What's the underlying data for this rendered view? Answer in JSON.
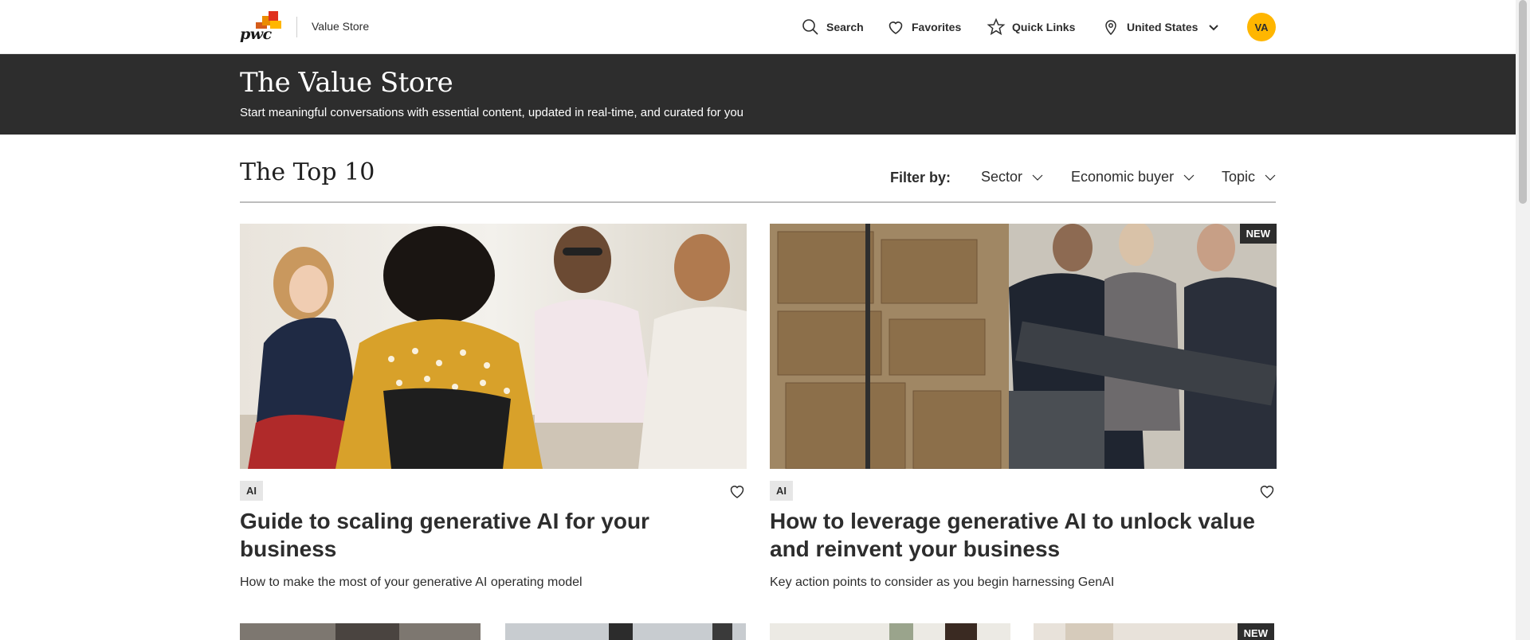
{
  "header": {
    "logo_text": "pwc",
    "app_name": "Value Store",
    "nav": {
      "search": "Search",
      "favorites": "Favorites",
      "quick_links": "Quick Links",
      "country": "United States"
    },
    "avatar_initials": "VA"
  },
  "hero": {
    "title": "The Value Store",
    "subtitle": "Start meaningful conversations with essential content, updated in real-time, and curated for you"
  },
  "section": {
    "title": "The Top 10",
    "filter_label": "Filter by:",
    "filters": [
      "Sector",
      "Economic buyer",
      "Topic"
    ]
  },
  "cards": [
    {
      "tag": "AI",
      "title": "Guide to scaling generative AI for your business",
      "description": "How to make the most of your generative AI operating model",
      "is_new": false
    },
    {
      "tag": "AI",
      "title": "How to leverage generative AI to unlock value and reinvent your business",
      "description": "Key action points to consider as you begin harnessing GenAI",
      "is_new": true,
      "badge": "NEW"
    }
  ],
  "bottom_row": {
    "last_badge": "NEW"
  },
  "colors": {
    "brand_orange": "#d04a02",
    "brand_red": "#e0301e",
    "brand_yellow": "#ffb600",
    "dark_band": "#2d2d2d"
  }
}
